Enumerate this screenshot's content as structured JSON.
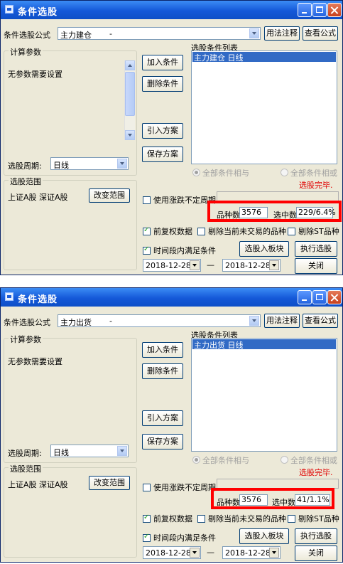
{
  "shared": {
    "formula_label": "条件选股公式",
    "usage_button": "用法注释",
    "view_formula_button": "查看公式",
    "calc_params_group": "计算参数",
    "no_params_text": "无参数需要设置",
    "period_label": "选股周期:",
    "period_value": "日线",
    "range_group": "选股范围",
    "range_text": "上证A股 深证A股",
    "change_range_button": "改变范围",
    "condition_list_label": "选股条件列表",
    "add_condition_button": "加入条件",
    "delete_condition_button": "删除条件",
    "import_plan_button": "引入方案",
    "save_plan_button": "保存方案",
    "radio_all_and": "全部条件相与",
    "radio_all_or": "全部条件相或",
    "status_text": "选股完毕.",
    "use_variable_period": "使用涨跌不定周期",
    "count_label": "品种数",
    "count_value": "3576",
    "selected_label": "选中数",
    "check_prior_rights": "前复权数据",
    "check_exclude_untraded": "剔除当前未交易的品种",
    "check_exclude_st": "剔除ST品种",
    "check_time_range": "时间段内满足条件",
    "select_to_block_button": "选股入板块",
    "run_select_button": "执行选股",
    "date_from": "2018-12-28",
    "date_sep": "—",
    "date_to": "2018-12-28",
    "close_button": "关闭"
  },
  "window1": {
    "title": "条件选股",
    "formula_value": "主力建仓",
    "formula_dash": "-",
    "list_item": "主力建仓  日线",
    "selected_value": "229/6.4%"
  },
  "window2": {
    "title": "条件选股",
    "formula_value": "主力出货",
    "formula_dash": "-",
    "list_item": "主力出货  日线",
    "selected_value": "41/1.1%"
  },
  "colors": {
    "title_bar": "#1458d8",
    "dialog_bg": "#ece9d8",
    "selection": "#316ac5",
    "status_red": "#e00000",
    "highlight_box": "#ff0000"
  }
}
